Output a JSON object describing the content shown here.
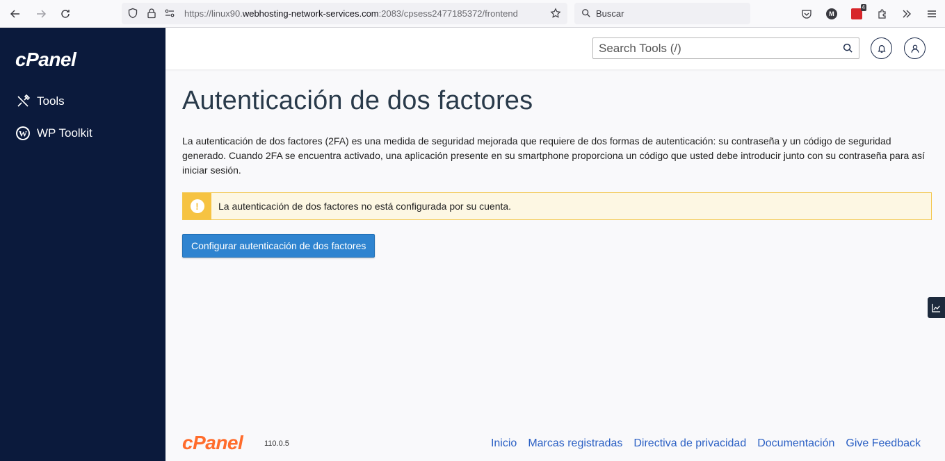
{
  "browser": {
    "url_prefix": "https://linux90.",
    "url_host": "webhosting-network-services.com",
    "url_suffix": ":2083/cpsess2477185372/frontend",
    "search_placeholder": "Buscar",
    "profile_initial": "M",
    "extension_badge_count": "4"
  },
  "sidebar": {
    "logo": "cPanel",
    "items": [
      {
        "label": "Tools",
        "icon": "tools-icon"
      },
      {
        "label": "WP Toolkit",
        "icon": "wordpress-icon"
      }
    ]
  },
  "header": {
    "search_placeholder": "Search Tools (/)"
  },
  "main": {
    "title": "Autenticación de dos factores",
    "description": "La autenticación de dos factores (2FA) es una medida de seguridad mejorada que requiere de dos formas de autenticación: su contraseña y un código de seguridad generado. Cuando 2FA se encuentra activado, una aplicación presente en su smartphone proporciona un código que usted debe introducir junto con su contraseña para así iniciar sesión.",
    "alert_text": "La autenticación de dos factores no está configurada por su cuenta.",
    "alert_icon_glyph": "!",
    "configure_button": "Configurar autenticación de dos factores"
  },
  "footer": {
    "logo": "cPanel",
    "version": "110.0.5",
    "links": [
      "Inicio",
      "Marcas registradas",
      "Directiva de privacidad",
      "Documentación",
      "Give Feedback"
    ]
  },
  "colors": {
    "sidebar_bg": "#0b1a3c",
    "primary": "#2f84d0",
    "warning": "#f6c342",
    "brand_orange": "#ff6c2c",
    "link": "#2b60c4"
  }
}
